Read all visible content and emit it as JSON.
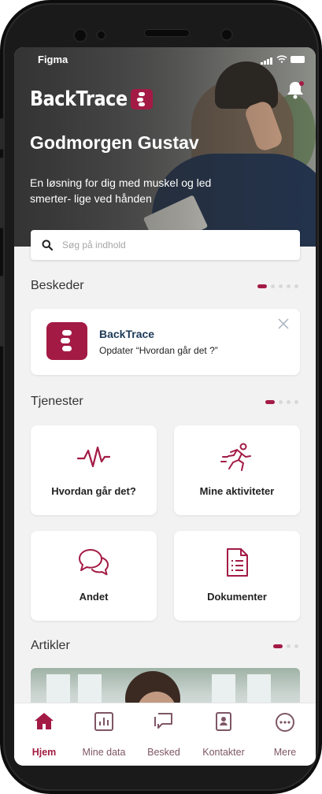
{
  "status_bar": {
    "carrier": "Figma"
  },
  "brand": {
    "name": "BackTrace",
    "accent": "#a31b45"
  },
  "header": {
    "greeting": "Godmorgen Gustav",
    "subtitle": "En løsning for dig med muskel og led smerter- lige ved hånden"
  },
  "search": {
    "placeholder": "Søg på indhold"
  },
  "messages": {
    "title": "Beskeder",
    "pages": 5,
    "active_page": 1,
    "card": {
      "sender": "BackTrace",
      "text": "Opdater “Hvordan går det ?”"
    }
  },
  "services": {
    "title": "Tjenester",
    "pages": 4,
    "active_page": 1,
    "items": [
      {
        "label": "Hvordan går det?",
        "icon": "pulse-icon"
      },
      {
        "label": "Mine aktiviteter",
        "icon": "running-icon"
      },
      {
        "label": "Andet",
        "icon": "chat-bubbles-icon"
      },
      {
        "label": "Dokumenter",
        "icon": "document-icon"
      }
    ]
  },
  "articles": {
    "title": "Artikler",
    "pages": 3,
    "active_page": 1
  },
  "tabbar": {
    "items": [
      {
        "label": "Hjem",
        "icon": "home-icon",
        "active": true
      },
      {
        "label": "Mine data",
        "icon": "chart-icon",
        "active": false
      },
      {
        "label": "Besked",
        "icon": "message-icon",
        "active": false
      },
      {
        "label": "Kontakter",
        "icon": "contacts-icon",
        "active": false
      },
      {
        "label": "Mere",
        "icon": "more-icon",
        "active": false
      }
    ]
  }
}
